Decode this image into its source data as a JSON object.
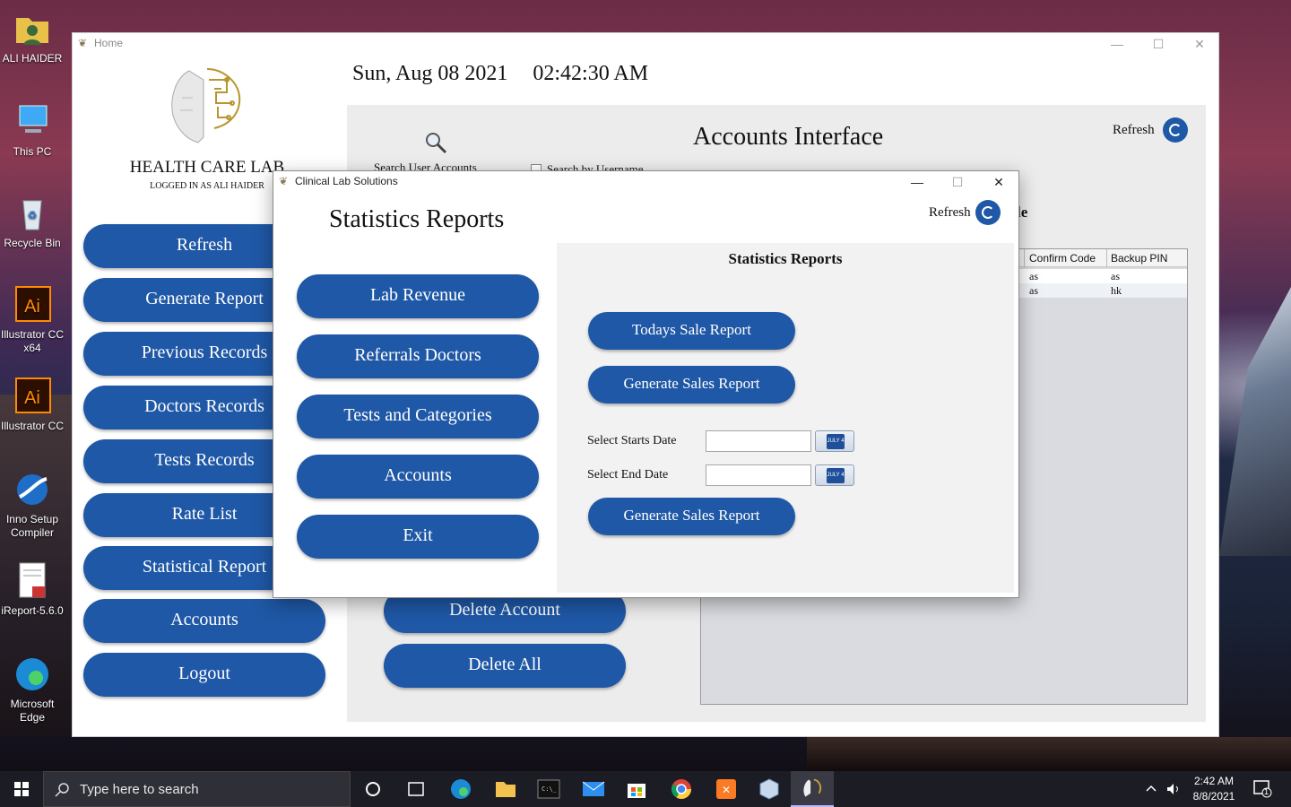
{
  "desktop": {
    "icons": [
      {
        "label": "ALI HAIDER",
        "icon": "user-folder-icon"
      },
      {
        "label": "This PC",
        "icon": "computer-icon"
      },
      {
        "label": "Recycle Bin",
        "icon": "recycle-bin-icon"
      },
      {
        "label": "Illustrator CC x64",
        "icon": "illustrator-icon"
      },
      {
        "label": "Illustrator CC",
        "icon": "illustrator-icon"
      },
      {
        "label": "Inno Setup Compiler",
        "icon": "inno-setup-icon"
      },
      {
        "label": "iReport-5.6.0",
        "icon": "ireport-icon"
      },
      {
        "label": "Microsoft Edge",
        "icon": "edge-icon"
      }
    ]
  },
  "main_window": {
    "title": "Home",
    "brand": "HEALTH CARE LAB",
    "logged_in": "LOGGED IN AS ALI HAIDER",
    "date": "Sun, Aug 08 2021",
    "time": "02:42:30 AM",
    "sidebar": [
      {
        "label": "Refresh"
      },
      {
        "label": "Generate Report"
      },
      {
        "label": "Previous Records"
      },
      {
        "label": "Doctors Records"
      },
      {
        "label": "Tests Records"
      },
      {
        "label": "Rate List"
      },
      {
        "label": "Statistical Report"
      },
      {
        "label": "Accounts"
      },
      {
        "label": "Logout"
      }
    ],
    "accounts": {
      "title": "Accounts Interface",
      "refresh_label": "Refresh",
      "search_label": "Search User Accounts",
      "search_by_username": "Search by  Username",
      "partial_heading": "le",
      "table": {
        "columns": [
          "Confirm Code",
          "Backup PIN"
        ],
        "rows": [
          [
            "as",
            "as"
          ],
          [
            "as",
            "hk"
          ]
        ]
      },
      "delete_account": "Delete  Account",
      "delete_all": "Delete All"
    }
  },
  "dialog": {
    "title": "Clinical Lab Solutions",
    "heading": "Statistics Reports",
    "refresh_label": "Refresh",
    "menu": [
      {
        "label": "Lab Revenue"
      },
      {
        "label": "Referrals Doctors"
      },
      {
        "label": "Tests and Categories"
      },
      {
        "label": "Accounts"
      },
      {
        "label": "Exit"
      }
    ],
    "panel": {
      "title": "Statistics Reports",
      "todays_sale": "Todays Sale Report",
      "generate_sales_1": "Generate Sales Report",
      "start_date_label": "Select Starts Date",
      "end_date_label": "Select End Date",
      "start_date_value": "",
      "end_date_value": "",
      "calendar_text": "JULY 4",
      "generate_sales_2": "Generate Sales Report"
    }
  },
  "taskbar": {
    "search_placeholder": "Type here to search",
    "time": "2:42 AM",
    "date": "8/8/2021",
    "notifications": "1"
  },
  "colors": {
    "primary_button": "#1f58a6",
    "panel_bg": "#ececec"
  }
}
